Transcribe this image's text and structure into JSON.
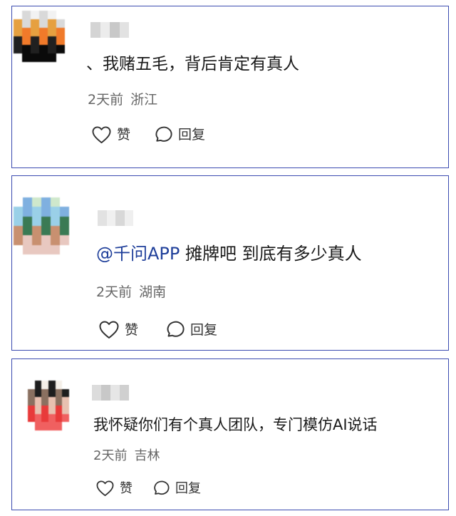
{
  "comments": [
    {
      "content": "、我赌五毛，背后肯定有真人",
      "time": "2天前",
      "location": "浙江",
      "like_label": "赞",
      "reply_label": "回复",
      "avatar_colors": [
        "#f2f2f2",
        "#d9d9d9",
        "#e6a040",
        "#f07a2a",
        "#202020",
        "#0a0a0a"
      ],
      "username_colors": [
        "#d4d4d4",
        "#ececec",
        "#c8c8c8",
        "#e2e2e2"
      ]
    },
    {
      "mention": "@千问APP",
      "content": " 摊牌吧 到底有多少真人",
      "time": "2天前",
      "location": "湖南",
      "like_label": "赞",
      "reply_label": "回复",
      "avatar_colors": [
        "#cfe8cc",
        "#7fb0e0",
        "#9ad0e8",
        "#3a7a54",
        "#c89070",
        "#e8c8c0"
      ],
      "username_colors": [
        "#e2e2e2",
        "#f0f0f0",
        "#d8d8d8",
        "#efefef"
      ]
    },
    {
      "content": "我怀疑你们有个真人团队，专门模仿AI说话",
      "time": "2天前",
      "location": "吉林",
      "like_label": "赞",
      "reply_label": "回复",
      "avatar_colors": [
        "#f4efe8",
        "#1e1e1e",
        "#8a7060",
        "#e8c0b0",
        "#e83a3a",
        "#f06060"
      ],
      "username_colors": [
        "#dcdcdc",
        "#c8c8c8",
        "#e6e6e6",
        "#d0d0d0"
      ]
    }
  ]
}
